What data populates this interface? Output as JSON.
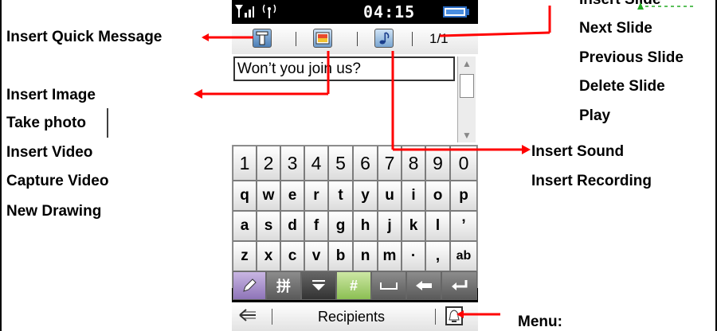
{
  "status": {
    "time": "04:15",
    "signal_icon": "signal-bars-icon",
    "antenna_icon": "antenna-icon",
    "battery_icon": "battery-full-icon"
  },
  "toolbar": {
    "quick_message_icon": "text-t-icon",
    "image_icon": "image-icon",
    "sound_icon": "music-note-icon",
    "page_counter": "1/1"
  },
  "compose": {
    "message_text": "Won’t you join us?"
  },
  "keyboard": {
    "row1": [
      "1",
      "2",
      "3",
      "4",
      "5",
      "6",
      "7",
      "8",
      "9",
      "0"
    ],
    "row2": [
      "q",
      "w",
      "e",
      "r",
      "t",
      "y",
      "u",
      "i",
      "o",
      "p"
    ],
    "row3": [
      "a",
      "s",
      "d",
      "f",
      "g",
      "h",
      "j",
      "k",
      "l",
      "’"
    ],
    "row4": [
      "z",
      "x",
      "c",
      "v",
      "b",
      "n",
      "m",
      "·",
      ",",
      "ab"
    ],
    "func_keys": [
      {
        "icon": "pencil-icon"
      },
      {
        "label": "拼"
      },
      {
        "icon": "hide-keyboard-icon"
      },
      {
        "label": "#"
      },
      {
        "icon": "space-icon"
      },
      {
        "icon": "backspace-icon"
      },
      {
        "icon": "enter-icon"
      }
    ]
  },
  "bottom": {
    "back_icon": "back-arrow-icon",
    "label": "Recipients",
    "menu_icon": "bell-icon"
  },
  "annotations": {
    "left": {
      "quick_message": "Insert Quick Message",
      "image_group": [
        "Insert Image",
        "Take photo",
        "Insert Video",
        "Capture Video",
        "New Drawing"
      ]
    },
    "right": {
      "slide_group": [
        "Insert Slide",
        "Next Slide",
        "Previous Slide",
        "Delete Slide",
        "Play"
      ],
      "sound_group": [
        "Insert Sound",
        "Insert Recording"
      ],
      "menu": "Menu:"
    }
  },
  "colors": {
    "annotation_line": "#ff0000",
    "battery": "#4a8ee0"
  }
}
